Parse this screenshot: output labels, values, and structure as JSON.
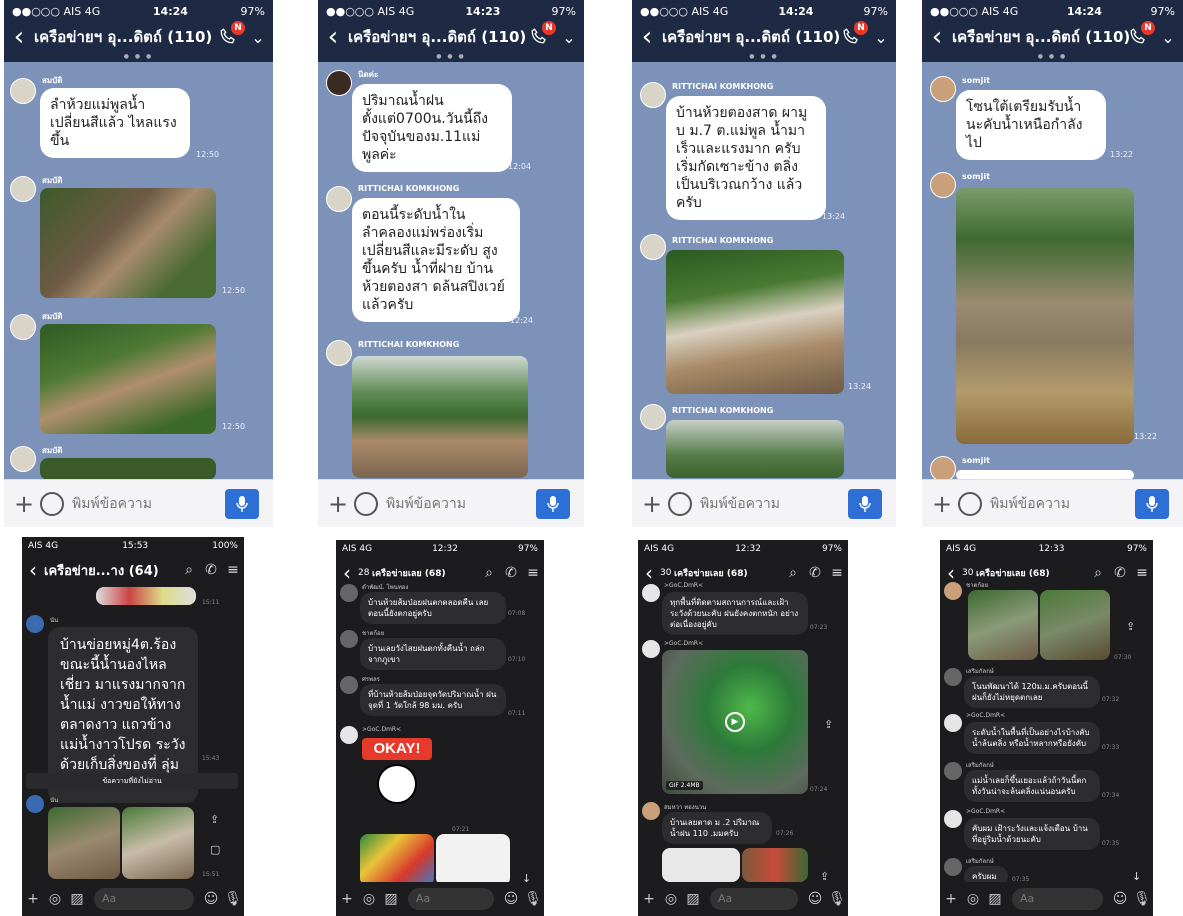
{
  "placeholder": "พิมพ์ข้อความ",
  "dark_placeholder": "Aa",
  "screens": [
    {
      "carrier": "●●○○○ AIS 4G",
      "time": "14:24",
      "battery": "97%",
      "title": "เครือข่ายฯ อุ...ดิตถ์ (110)",
      "badge": "N",
      "msgs": [
        {
          "sender": "สมบัติ",
          "text": "ลำห้วยแม่พูลน้ำ เปลี่ยนสีแล้ว ไหลแรงขึ้น",
          "time": "12:50"
        },
        {
          "sender": "สมบัติ",
          "time": "12:50"
        },
        {
          "sender": "สมบัติ",
          "time": "12:50"
        },
        {
          "sender": "สมบัติ"
        }
      ]
    },
    {
      "carrier": "●●○○○ AIS 4G",
      "time": "14:23",
      "battery": "97%",
      "title": "เครือข่ายฯ อุ...ดิตถ์ (110)",
      "badge": "N",
      "msgs": [
        {
          "sender": "นิดค่ะ",
          "text": "ปริมาณน้ำฝน ตั้งแต่0700น.วันนี้ถึง ปัจจุบันของม.11แม่ พูลค่ะ",
          "time": "12:04"
        },
        {
          "sender": "RITTICHAI KOMKHONG",
          "text": "ตอนนี้ระดับน้ำใน ลำคลองแม่พร่องเริ่ม เปลี่ยนสีและมีระดับ สูงขึ้นครับ น้ำที่ฝาย บ้านห้วยตองสา ดล้นสปิงเวย์แล้วครับ",
          "time": "12:24"
        },
        {
          "sender": "RITTICHAI KOMKHONG"
        }
      ]
    },
    {
      "carrier": "●●○○○ AIS 4G",
      "time": "14:24",
      "battery": "97%",
      "title": "เครือข่ายฯ อุ...ดิตถ์ (110)",
      "badge": "N",
      "msgs": [
        {
          "sender": "RITTICHAI KOMKHONG",
          "text": "บ้านห้วยตองสาด ผามูบ ม.7 ต.แม่พูล น้ำมาเร็วและแรงมาก ครับเริ่มกัดเซาะข้าง ตลิ่งเป็นบริเวณกว้าง แล้วครับ",
          "time": "13:24"
        },
        {
          "sender": "RITTICHAI KOMKHONG",
          "time": "13:24"
        },
        {
          "sender": "RITTICHAI KOMKHONG"
        }
      ]
    },
    {
      "carrier": "●●○○○ AIS 4G",
      "time": "14:24",
      "battery": "97%",
      "title": "เครือข่ายฯ อุ...ดิตถ์ (110)",
      "badge": "N",
      "msgs": [
        {
          "sender": "somjit",
          "text": "โซนใต้เตรียมรับน้ำ นะคับน้ำเหนือกำลัง ไป",
          "time": "13:22"
        },
        {
          "sender": "somjit",
          "time": "13:22"
        },
        {
          "sender": "somjit"
        }
      ]
    },
    {
      "carrier": "AIS 4G",
      "time": "15:53",
      "battery": "100%",
      "title": "เครือข่าย...าง (64)",
      "top_time": "15:11",
      "msgs": [
        {
          "sender": "นัน",
          "text": "บ้านข่อยหมู่4ต.ร้อง ขณะนี้น้ำนองไหลเชี่ยว มาแรงมากจากน้ำแม่ งาวขอให้ทางตลาดงาว แถวข้างแม่น้ำงาวโปรด ระวังด้วยเก็บสิ่งของที่ ลุ่มต่ำด้วย",
          "time": "15:43"
        },
        {
          "sender": "นัน",
          "time": "15:51"
        }
      ],
      "unread": "ข้อความที่ยังไม่อ่าน"
    },
    {
      "carrier": "AIS 4G",
      "time": "12:32",
      "battery": "97%",
      "title": "เครือข่ายเลย (68)",
      "back_count": "28",
      "msgs": [
        {
          "sender": "ดำพัฒน์. โพนทอง",
          "text": "บ้านห้วยส้มป่อยฝนตกตลอดคืน เลยตอนนี้ยังตกอยู่ครับ",
          "time": "07:08"
        },
        {
          "sender": "ชาตก้อย",
          "text": "บ้านเลยวังไสยฝนตกทั้งคืนน้ำ ถล่กจากภูเขา",
          "time": "07:10"
        },
        {
          "sender": "ศรพลร",
          "text": "ที่บ้านห้วยส้มป่อยจุดวัดปริมาณน้ำ ฝนจุดที่ 1 วัดใกล้ 98 มม. ครับ",
          "time": "07:11"
        },
        {
          "sender": ">GoC.DmR<",
          "sticker": "OKAY!",
          "time": "07:21"
        }
      ]
    },
    {
      "carrier": "AIS 4G",
      "time": "12:32",
      "battery": "97%",
      "title": "เครือข่ายเลย (68)",
      "back_count": "30",
      "msgs": [
        {
          "sender": ">GoC.DmR<",
          "text": "ทุกพื้นที่ติดตามสถานการณ์และเฝ้า ระวังด้วยนะคับ ฝนยังคงตกหนัก อย่างต่อเนื่องอยู่คับ",
          "time": "07:23"
        },
        {
          "sender": ">GoC.DmR<",
          "gif": "GIF",
          "size": "2.4MB",
          "time": "07:24"
        },
        {
          "sender": "สมหวา ทองนวน",
          "text": "บ้านเลยตาด ม .2 ปริมาณน้ำฝน 110 .มมครับ",
          "time": "07:26"
        }
      ]
    },
    {
      "carrier": "AIS 4G",
      "time": "12:33",
      "battery": "97%",
      "title": "เครือข่ายเลย (68)",
      "back_count": "30",
      "msgs": [
        {
          "sender": "ชาตก้อย",
          "time": "07:30"
        },
        {
          "sender": "เสริมกัลกษ์",
          "text": "โนนพัฒนาได้ 120ม.ม.ครับตอนนี้ ฝนก็ยังไม่หยุดตกเลย",
          "time": "07:32"
        },
        {
          "sender": ">GoC.DmR<",
          "text": "ระดับน้ำในพื้นที่เป็นอย่างไรบ้างคับ น้ำล้นตลิ่ง หรือน้ำหลากหรือยังคับ",
          "time": "07:33"
        },
        {
          "sender": "เสริมกัลกษ์",
          "text": "แม่น้ำเลยก็ขึ้นเยอะแล้วถ้าวันนี้ตก ทั้งวันน่าจะล้นตลิ่งแน่นอนครับ",
          "time": "07:34"
        },
        {
          "sender": ">GoC.DmR<",
          "text": "คับผม เฝ้าระวังและแจ้งเตือน บ้าน ที่อยู่ริมน้ำด้วยนะคับ",
          "time": "07:35"
        },
        {
          "sender": "เสริมกัลกษ์",
          "text": "ครับผม",
          "time": "07:35"
        }
      ]
    }
  ],
  "icons": [
    "back-icon",
    "call-icon",
    "chevron-down-icon",
    "plus-icon",
    "emoji-icon",
    "mic-icon",
    "search-icon",
    "menu-icon",
    "camera-icon",
    "gallery-icon",
    "share-icon",
    "play-icon"
  ],
  "colors": {
    "line_header": "#1e2944",
    "line_bg": "#7d92b8",
    "send_blue": "#2e6fd6",
    "dark_bg": "#1c1c1e"
  }
}
